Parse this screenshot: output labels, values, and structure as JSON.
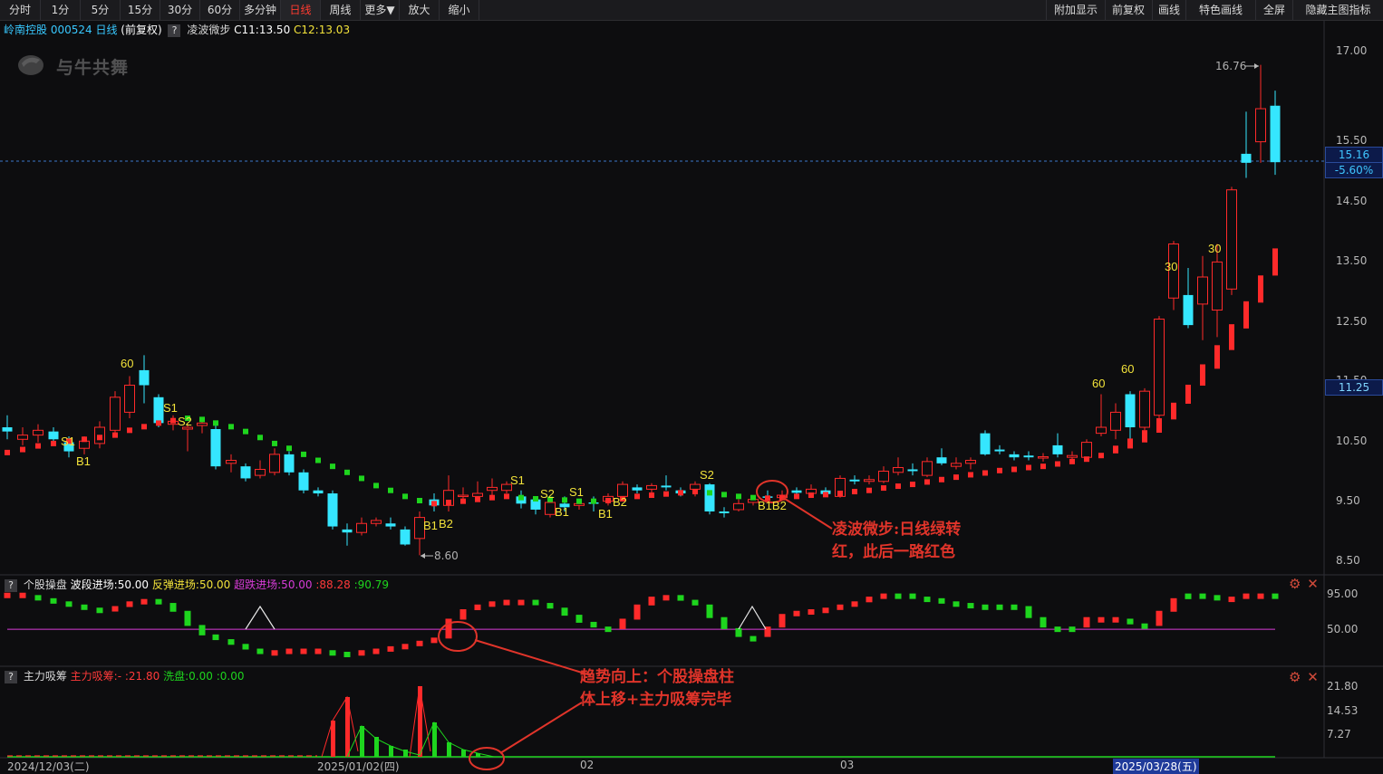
{
  "toolbar": {
    "left_items": [
      "分时",
      "1分",
      "5分",
      "15分",
      "30分",
      "60分",
      "多分钟",
      "日线",
      "周线",
      "更多▼",
      "放大",
      "缩小"
    ],
    "active": "日线",
    "right_items": [
      "附加显示",
      "前复权",
      "画线",
      "特色画线",
      "全屏",
      "隐藏主图指标"
    ]
  },
  "info": {
    "stock": "岭南控股 000524 日线",
    "adjust": "(前复权)",
    "help": "?",
    "indicator": "凌波微步",
    "c1": "C11:13.50",
    "c2": "C12:13.03"
  },
  "logo": "与牛共舞",
  "price_axis": [
    "17.00",
    "15.50",
    "14.50",
    "13.50",
    "12.50",
    "11.50",
    "10.50",
    "9.50",
    "8.50"
  ],
  "price_tags": {
    "current": "15.16",
    "change": "-5.60%",
    "mark": "11.25"
  },
  "annotations": {
    "high": "16.76",
    "low": "8.60"
  },
  "labels": {
    "s1": "S1",
    "s2": "S2",
    "b1": "B1",
    "b2": "B2",
    "b1b2": "B1B2",
    "n60": "60",
    "n30": "30"
  },
  "notes": {
    "main_1": "凌波微步:日线绿转",
    "main_2": "红，此后一路红色",
    "sub_1": "趋势向上：个股操盘柱",
    "sub_2": "体上移+主力吸筹完毕"
  },
  "panel1": {
    "help": "?",
    "name": "个股操盘",
    "v1": "波段进场:50.00",
    "v2": "反弹进场:50.00",
    "v3": "超跌进场:50.00",
    "v4": ":88.28",
    "v5": ":90.79",
    "axis": [
      "95.00",
      "50.00"
    ]
  },
  "panel2": {
    "help": "?",
    "name": "主力吸筹",
    "v1": "主力吸筹:-",
    "v2": ":21.80",
    "v3": "洗盘:0.00",
    "v4": ":0.00",
    "axis": [
      "21.80",
      "14.53",
      "7.27"
    ]
  },
  "dates": [
    "2024/12/03(二)",
    "2025/01/02(四)",
    "02",
    "03",
    "2025/03/28(五)"
  ],
  "colors": {
    "up": "#ff2a2a",
    "down": "#35e6ff",
    "green": "#1ed51e",
    "yellow": "#f2e23a",
    "magenta": "#d83cd8"
  }
}
